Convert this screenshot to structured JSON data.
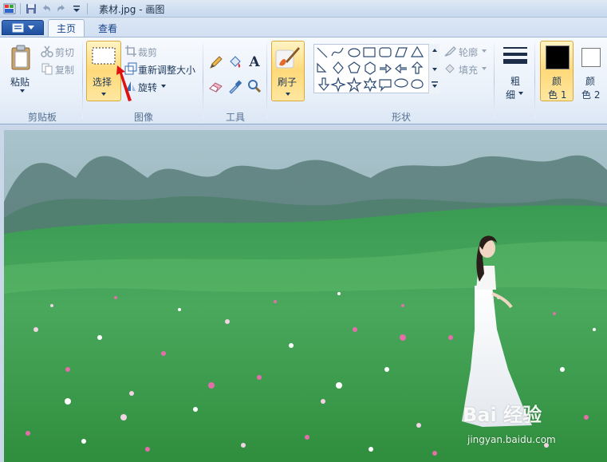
{
  "window": {
    "title": "素材.jpg - 画图"
  },
  "tabs": {
    "home": "主页",
    "view": "查看"
  },
  "clipboard": {
    "paste": "粘贴",
    "cut": "剪切",
    "copy": "复制",
    "group": "剪贴板"
  },
  "image": {
    "select": "选择",
    "crop": "裁剪",
    "resize": "重新调整大小",
    "rotate": "旋转",
    "group": "图像"
  },
  "tools": {
    "group": "工具",
    "text_glyph": "A"
  },
  "brushes": {
    "label": "刷子"
  },
  "shapes": {
    "group": "形状",
    "outline": "轮廓",
    "fill": "填充"
  },
  "size": {
    "line1": "粗",
    "line2": "细"
  },
  "colors": {
    "color1_line1": "颜",
    "color1_line2": "色 1",
    "color2_line1": "颜",
    "color2_line2": "色 2",
    "color1_value": "#000000",
    "color2_value": "#ffffff"
  },
  "watermark": {
    "main": "Bai 经验",
    "sub": "jingyan.baidu.com"
  },
  "accent_colors": {
    "ribbon_blue": "#15428b",
    "highlight_orange": "#ffd97a",
    "arrow_red": "#e01010"
  }
}
